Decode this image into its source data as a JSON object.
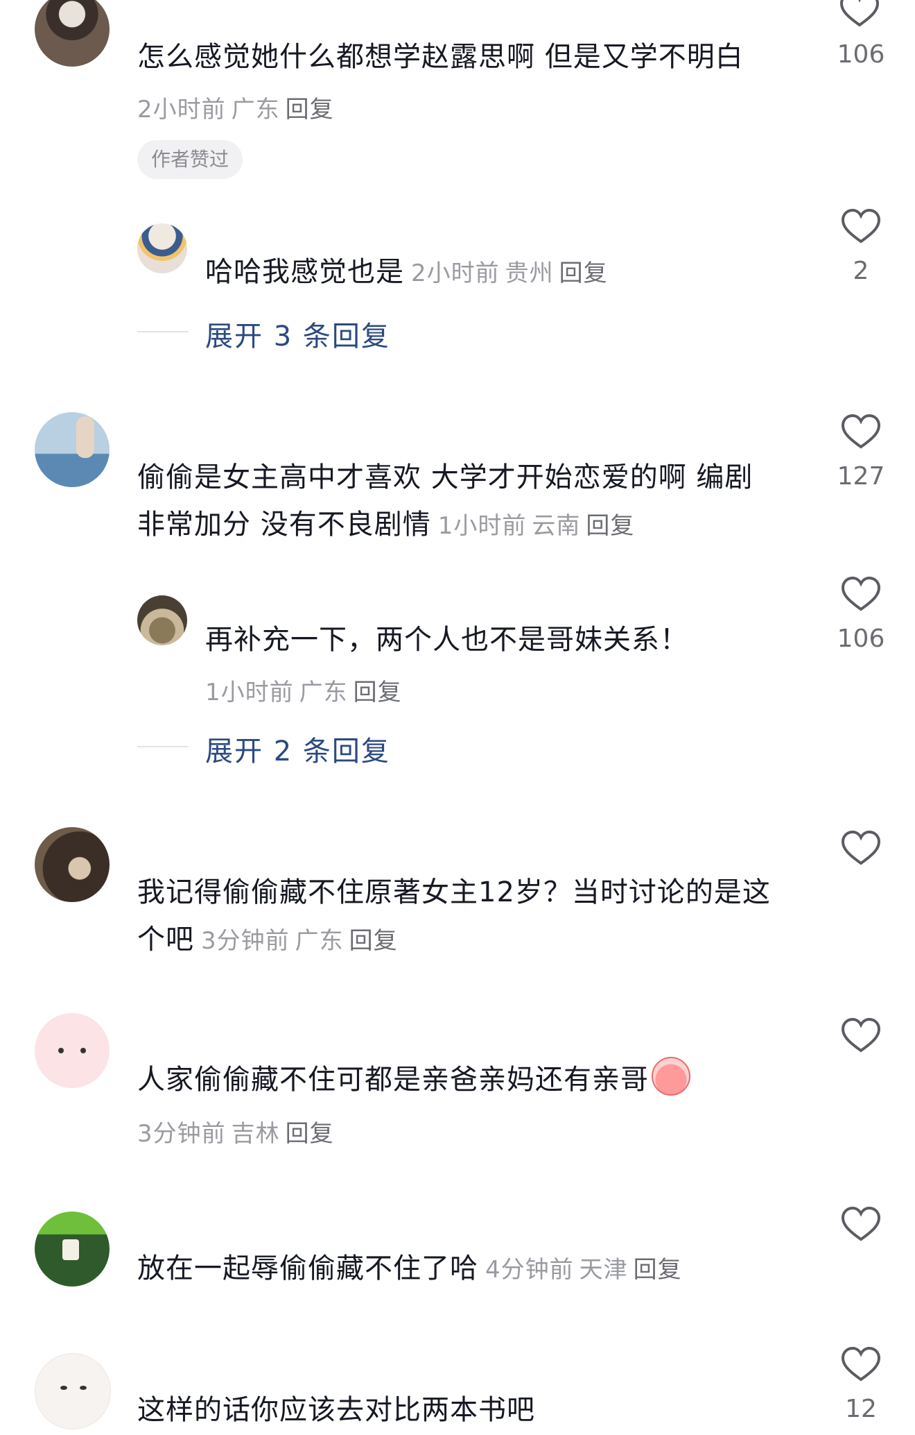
{
  "comments": [
    {
      "text": "怎么感觉她什么都想学赵露思啊 但是又学不明白",
      "time": "2小时前",
      "location": "广东",
      "reply": "回复",
      "badge": "作者赞过",
      "likes": "106",
      "avatar_icon": "user-photo-avatar",
      "sub_reply": {
        "text": "哈哈我感觉也是",
        "time": "2小时前",
        "location": "贵州",
        "reply": "回复",
        "likes": "2",
        "avatar_icon": "doll-avatar"
      },
      "expand": "展开 3 条回复"
    },
    {
      "text_line1": "偷偷是女主高中才喜欢 大学才开始恋爱的啊 编剧",
      "text_line2": "非常加分 没有不良剧情",
      "time": "1小时前",
      "location": "云南",
      "reply": "回复",
      "likes": "127",
      "avatar_icon": "seaside-photo-avatar",
      "sub_reply": {
        "text": "再补充一下，两个人也不是哥妹关系！",
        "time": "1小时前",
        "location": "广东",
        "reply": "回复",
        "likes": "106",
        "avatar_icon": "user-photo-avatar"
      },
      "expand": "展开 2 条回复"
    },
    {
      "text_line1": "我记得偷偷藏不住原著女主12岁？当时讨论的是这",
      "text_line2": "个吧",
      "time": "3分钟前",
      "location": "广东",
      "reply": "回复",
      "likes": "",
      "avatar_icon": "hand-photo-avatar"
    },
    {
      "text": "人家偷偷藏不住可都是亲爸亲妈还有亲哥",
      "emoji_icon": "crying-face-emoji",
      "time": "3分钟前",
      "location": "吉林",
      "reply": "回复",
      "likes": "",
      "avatar_icon": "pink-cartoon-avatar"
    },
    {
      "text": "放在一起辱偷偷藏不住了哈",
      "time": "4分钟前",
      "location": "天津",
      "reply": "回复",
      "likes": "",
      "avatar_icon": "mahjong-avatar"
    },
    {
      "text": "这样的话你应该去对比两本书吧",
      "likes": "12",
      "avatar_icon": "cartoon-face-avatar"
    }
  ],
  "colors": {
    "text": "#161823",
    "meta": "#9a9ba1",
    "reply": "#6b6c72",
    "expand": "#2b4a80",
    "badge_bg": "#f1f1f3"
  }
}
